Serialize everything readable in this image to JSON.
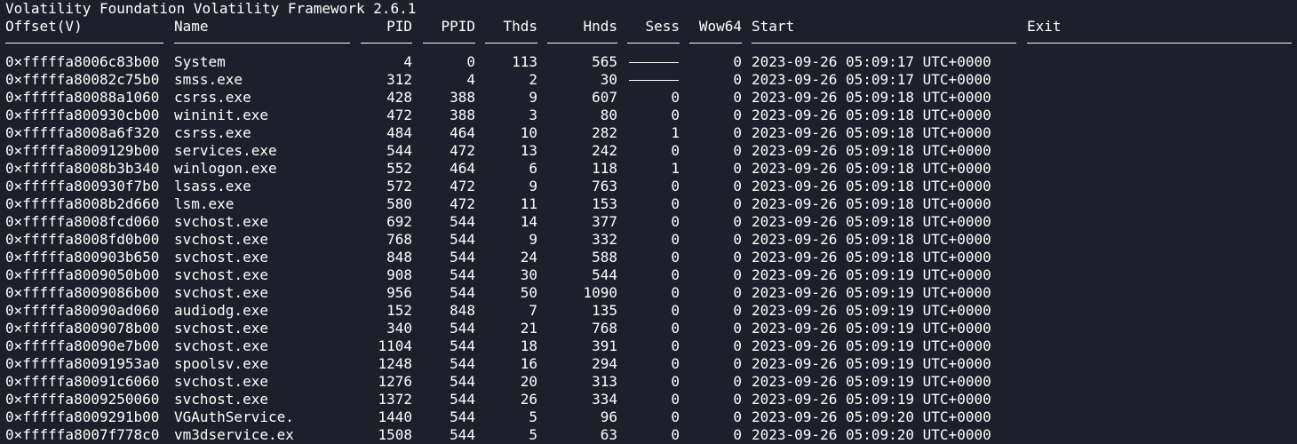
{
  "banner": "Volatility Foundation Volatility Framework 2.6.1",
  "headers": {
    "offset": "Offset(V)",
    "name": "Name",
    "pid": "PID",
    "ppid": "PPID",
    "thds": "Thds",
    "hnds": "Hnds",
    "sess": "Sess",
    "wow64": "Wow64",
    "start": "Start",
    "exit": "Exit"
  },
  "rows": [
    {
      "offset": "0×fffffa8006c83b00",
      "name": "System",
      "pid": "4",
      "ppid": "0",
      "thds": "113",
      "hnds": "565",
      "sess": "",
      "wow64": "0",
      "start": "2023-09-26 05:09:17 UTC+0000",
      "exit": ""
    },
    {
      "offset": "0×fffffa80082c75b0",
      "name": "smss.exe",
      "pid": "312",
      "ppid": "4",
      "thds": "2",
      "hnds": "30",
      "sess": "",
      "wow64": "0",
      "start": "2023-09-26 05:09:17 UTC+0000",
      "exit": ""
    },
    {
      "offset": "0×fffffa80088a1060",
      "name": "csrss.exe",
      "pid": "428",
      "ppid": "388",
      "thds": "9",
      "hnds": "607",
      "sess": "0",
      "wow64": "0",
      "start": "2023-09-26 05:09:18 UTC+0000",
      "exit": ""
    },
    {
      "offset": "0×fffffa800930cb00",
      "name": "wininit.exe",
      "pid": "472",
      "ppid": "388",
      "thds": "3",
      "hnds": "80",
      "sess": "0",
      "wow64": "0",
      "start": "2023-09-26 05:09:18 UTC+0000",
      "exit": ""
    },
    {
      "offset": "0×fffffa8008a6f320",
      "name": "csrss.exe",
      "pid": "484",
      "ppid": "464",
      "thds": "10",
      "hnds": "282",
      "sess": "1",
      "wow64": "0",
      "start": "2023-09-26 05:09:18 UTC+0000",
      "exit": ""
    },
    {
      "offset": "0×fffffa8009129b00",
      "name": "services.exe",
      "pid": "544",
      "ppid": "472",
      "thds": "13",
      "hnds": "242",
      "sess": "0",
      "wow64": "0",
      "start": "2023-09-26 05:09:18 UTC+0000",
      "exit": ""
    },
    {
      "offset": "0×fffffa8008b3b340",
      "name": "winlogon.exe",
      "pid": "552",
      "ppid": "464",
      "thds": "6",
      "hnds": "118",
      "sess": "1",
      "wow64": "0",
      "start": "2023-09-26 05:09:18 UTC+0000",
      "exit": ""
    },
    {
      "offset": "0×fffffa800930f7b0",
      "name": "lsass.exe",
      "pid": "572",
      "ppid": "472",
      "thds": "9",
      "hnds": "763",
      "sess": "0",
      "wow64": "0",
      "start": "2023-09-26 05:09:18 UTC+0000",
      "exit": ""
    },
    {
      "offset": "0×fffffa8008b2d660",
      "name": "lsm.exe",
      "pid": "580",
      "ppid": "472",
      "thds": "11",
      "hnds": "153",
      "sess": "0",
      "wow64": "0",
      "start": "2023-09-26 05:09:18 UTC+0000",
      "exit": ""
    },
    {
      "offset": "0×fffffa8008fcd060",
      "name": "svchost.exe",
      "pid": "692",
      "ppid": "544",
      "thds": "14",
      "hnds": "377",
      "sess": "0",
      "wow64": "0",
      "start": "2023-09-26 05:09:18 UTC+0000",
      "exit": ""
    },
    {
      "offset": "0×fffffa8008fd0b00",
      "name": "svchost.exe",
      "pid": "768",
      "ppid": "544",
      "thds": "9",
      "hnds": "332",
      "sess": "0",
      "wow64": "0",
      "start": "2023-09-26 05:09:18 UTC+0000",
      "exit": ""
    },
    {
      "offset": "0×fffffa800903b650",
      "name": "svchost.exe",
      "pid": "848",
      "ppid": "544",
      "thds": "24",
      "hnds": "588",
      "sess": "0",
      "wow64": "0",
      "start": "2023-09-26 05:09:18 UTC+0000",
      "exit": ""
    },
    {
      "offset": "0×fffffa8009050b00",
      "name": "svchost.exe",
      "pid": "908",
      "ppid": "544",
      "thds": "30",
      "hnds": "544",
      "sess": "0",
      "wow64": "0",
      "start": "2023-09-26 05:09:19 UTC+0000",
      "exit": ""
    },
    {
      "offset": "0×fffffa8009086b00",
      "name": "svchost.exe",
      "pid": "956",
      "ppid": "544",
      "thds": "50",
      "hnds": "1090",
      "sess": "0",
      "wow64": "0",
      "start": "2023-09-26 05:09:19 UTC+0000",
      "exit": ""
    },
    {
      "offset": "0×fffffa80090ad060",
      "name": "audiodg.exe",
      "pid": "152",
      "ppid": "848",
      "thds": "7",
      "hnds": "135",
      "sess": "0",
      "wow64": "0",
      "start": "2023-09-26 05:09:19 UTC+0000",
      "exit": ""
    },
    {
      "offset": "0×fffffa8009078b00",
      "name": "svchost.exe",
      "pid": "340",
      "ppid": "544",
      "thds": "21",
      "hnds": "768",
      "sess": "0",
      "wow64": "0",
      "start": "2023-09-26 05:09:19 UTC+0000",
      "exit": ""
    },
    {
      "offset": "0×fffffa80090e7b00",
      "name": "svchost.exe",
      "pid": "1104",
      "ppid": "544",
      "thds": "18",
      "hnds": "391",
      "sess": "0",
      "wow64": "0",
      "start": "2023-09-26 05:09:19 UTC+0000",
      "exit": ""
    },
    {
      "offset": "0×fffffa80091953a0",
      "name": "spoolsv.exe",
      "pid": "1248",
      "ppid": "544",
      "thds": "16",
      "hnds": "294",
      "sess": "0",
      "wow64": "0",
      "start": "2023-09-26 05:09:19 UTC+0000",
      "exit": ""
    },
    {
      "offset": "0×fffffa80091c6060",
      "name": "svchost.exe",
      "pid": "1276",
      "ppid": "544",
      "thds": "20",
      "hnds": "313",
      "sess": "0",
      "wow64": "0",
      "start": "2023-09-26 05:09:19 UTC+0000",
      "exit": ""
    },
    {
      "offset": "0×fffffa8009250060",
      "name": "svchost.exe",
      "pid": "1372",
      "ppid": "544",
      "thds": "26",
      "hnds": "334",
      "sess": "0",
      "wow64": "0",
      "start": "2023-09-26 05:09:19 UTC+0000",
      "exit": ""
    },
    {
      "offset": "0×fffffa8009291b00",
      "name": "VGAuthService.",
      "pid": "1440",
      "ppid": "544",
      "thds": "5",
      "hnds": "96",
      "sess": "0",
      "wow64": "0",
      "start": "2023-09-26 05:09:20 UTC+0000",
      "exit": ""
    },
    {
      "offset": "0×fffffa8007f778c0",
      "name": "vm3dservice.ex",
      "pid": "1508",
      "ppid": "544",
      "thds": "5",
      "hnds": "63",
      "sess": "0",
      "wow64": "0",
      "start": "2023-09-26 05:09:20 UTC+0000",
      "exit": ""
    }
  ],
  "colors": {
    "background": "#1d1f2a",
    "text": "#ffffff"
  }
}
